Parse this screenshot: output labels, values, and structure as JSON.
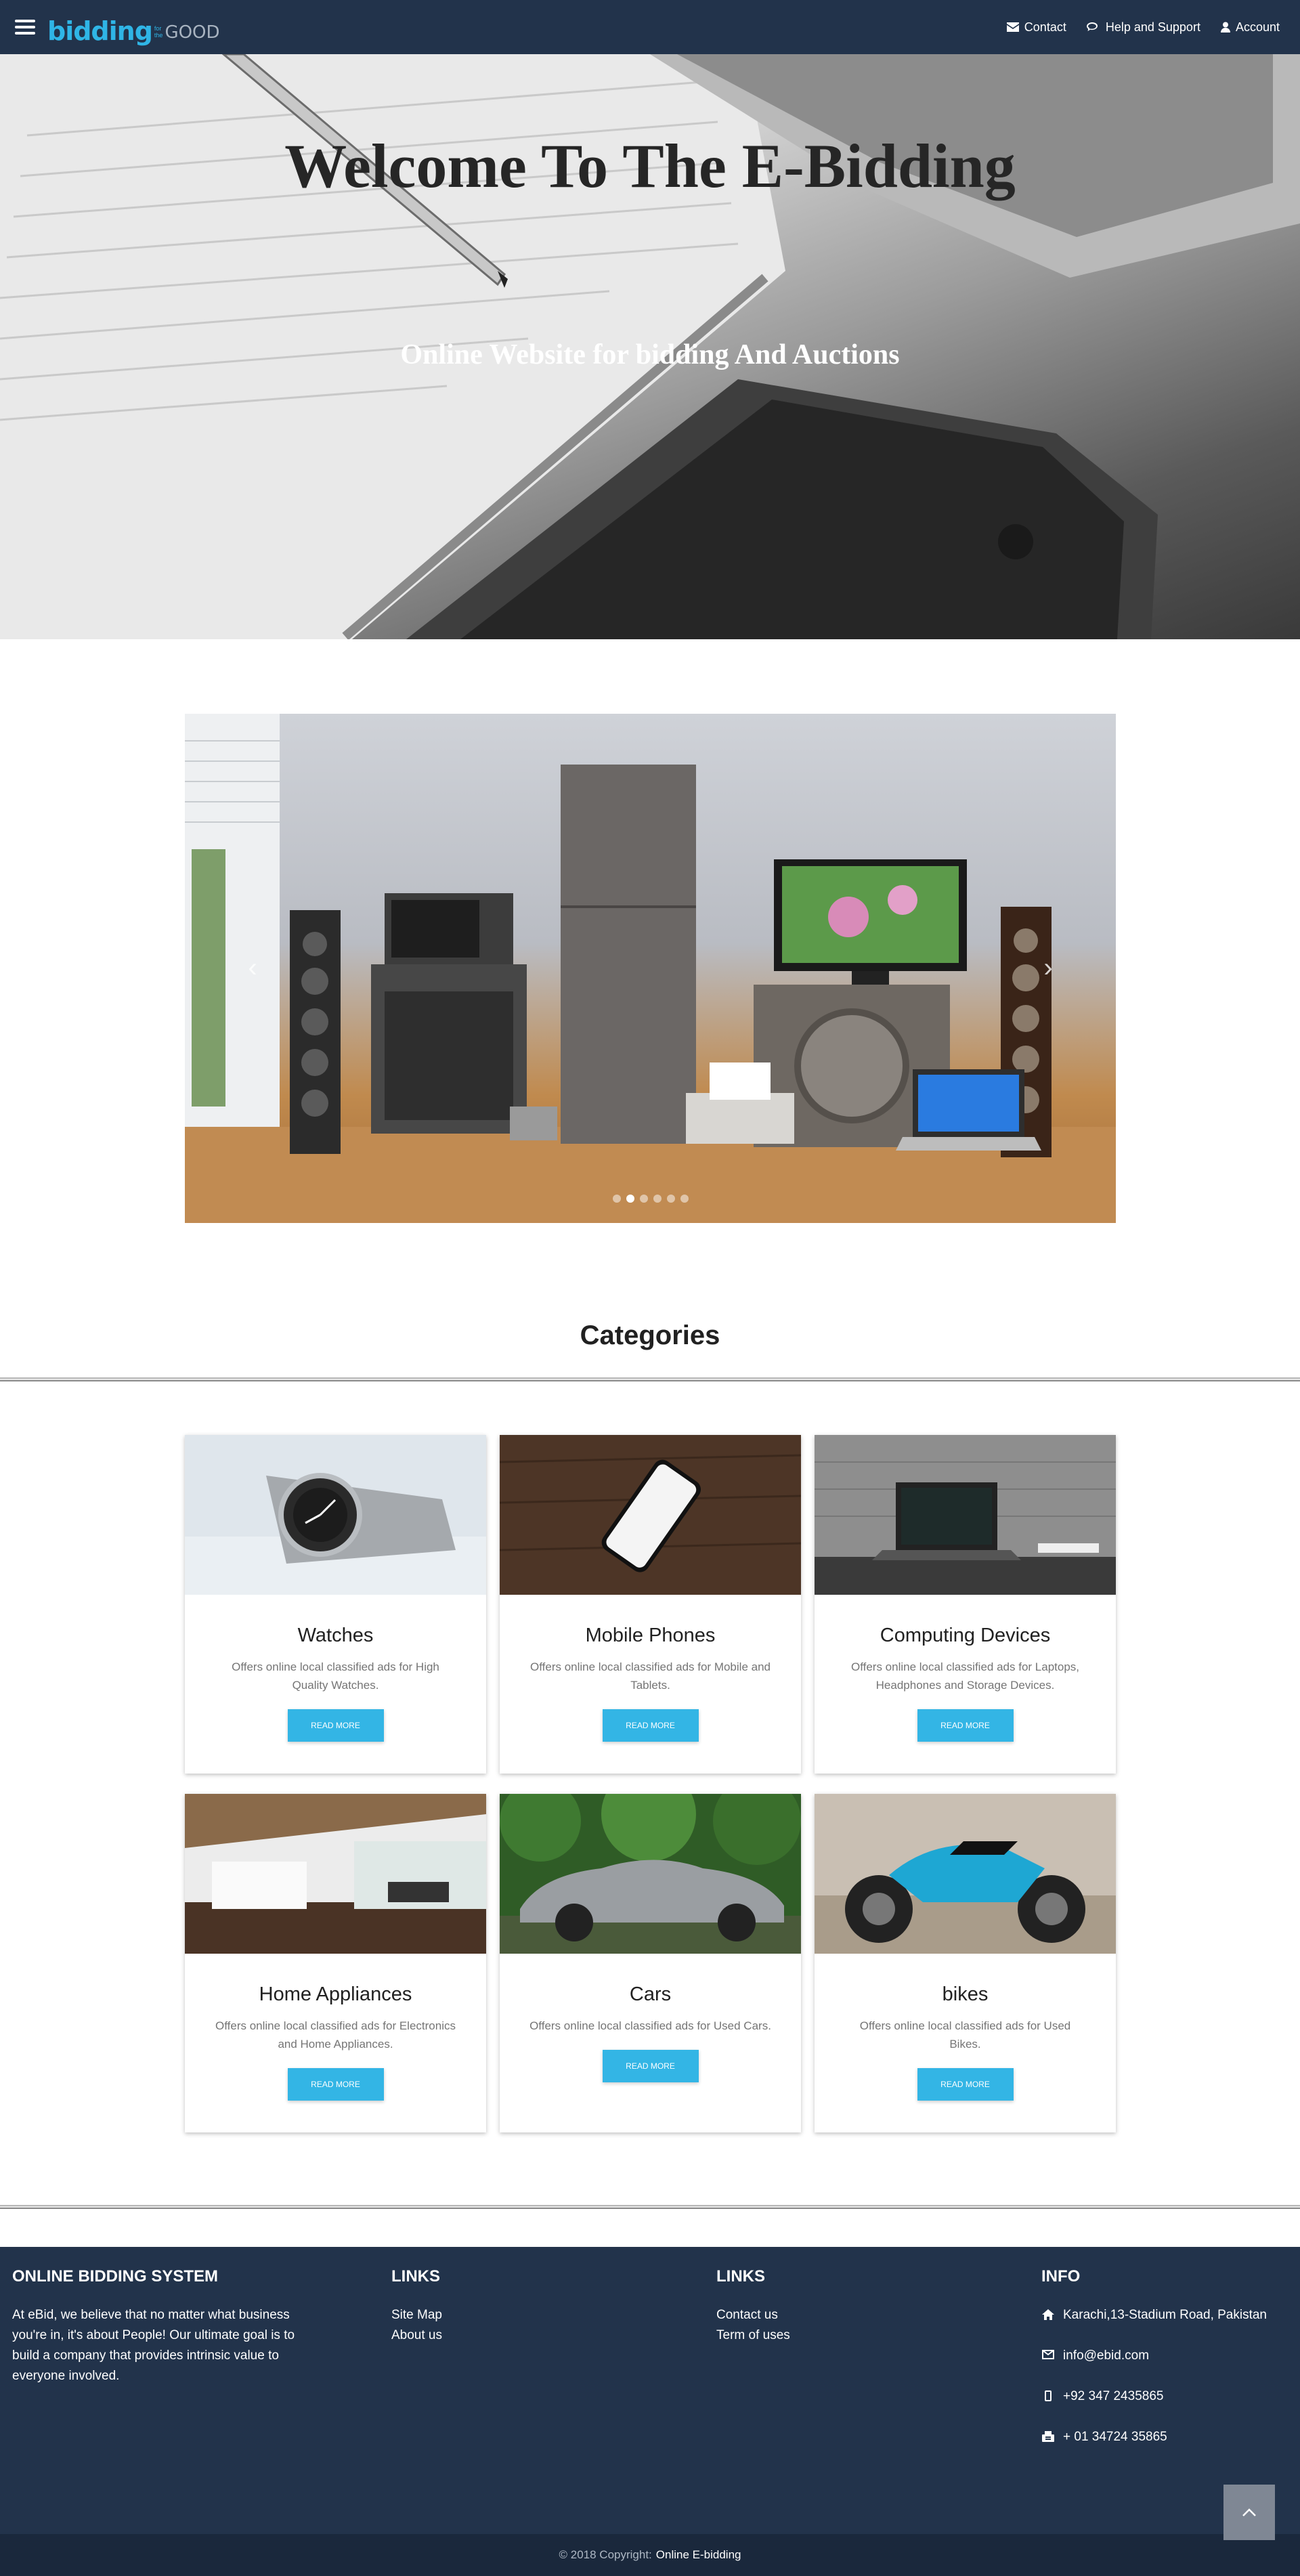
{
  "colors": {
    "navbar": "#22334b",
    "accent": "#33b5e5",
    "footer": "#22334b",
    "copyright_bar": "#1a283c"
  },
  "nav": {
    "logo_main": "bidding",
    "logo_small_top": "for",
    "logo_small_bottom": "the",
    "logo_good": "GOOD",
    "links": [
      {
        "label": "Contact",
        "icon": "envelope-icon"
      },
      {
        "label": "Help and Support",
        "icon": "chat-icon"
      },
      {
        "label": "Account",
        "icon": "user-icon"
      }
    ]
  },
  "hero": {
    "title": "Welcome To The E-Bidding",
    "subtitle": "Online Website for bidding And Auctions"
  },
  "carousel": {
    "prev_label": "‹",
    "next_label": "›",
    "indicator_count": 6,
    "active_index": 1
  },
  "categories": {
    "heading": "Categories",
    "button_label": "READ MORE",
    "items": [
      {
        "title": "Watches",
        "desc": "Offers online local classified ads for High Quality Watches."
      },
      {
        "title": "Mobile Phones",
        "desc": "Offers online local classified ads for Mobile and Tablets."
      },
      {
        "title": "Computing Devices",
        "desc": "Offers online local classified ads for Laptops, Headphones and Storage Devices."
      },
      {
        "title": "Home Appliances",
        "desc": "Offers online local classified ads for Electronics and Home Appliances."
      },
      {
        "title": "Cars",
        "desc": "Offers online local classified ads for Used Cars."
      },
      {
        "title": "bikes",
        "desc": "Offers online local classified ads for Used Bikes."
      }
    ]
  },
  "footer": {
    "about_title": "Online bidding system",
    "about_text": "At eBid, we believe that no matter what business you're in, it's about People! Our ultimate goal is to build a company that provides intrinsic value to everyone involved.",
    "links1_title": "Links",
    "links1": [
      "Site Map",
      "About us"
    ],
    "links2_title": "Links",
    "links2": [
      "Contact us",
      "Term of uses"
    ],
    "info_title": "Info",
    "address": "Karachi,13-Stadium Road, Pakistan",
    "email": "info@ebid.com",
    "phone": "+92 347 2435865",
    "fax": "+ 01 34724 35865"
  },
  "copyright": {
    "prefix": "© 2018 Copyright:",
    "link": "Online E-bidding"
  }
}
